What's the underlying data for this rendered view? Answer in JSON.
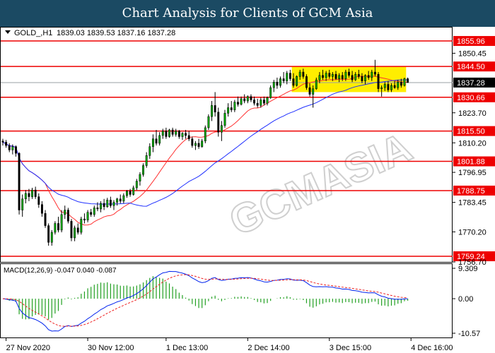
{
  "header": {
    "title": "Chart Analysis for Clients of GCM Asia"
  },
  "colors": {
    "title_bg": "#1b4a63",
    "bull": "#00aa00",
    "bear": "#000000",
    "ma_fast": "#ff3030",
    "ma_slow": "#2030ff",
    "hline": "#ee0000",
    "highlight": "#ffee00",
    "macd_hist": "#22a022",
    "macd_line": "#0022ee",
    "macd_signal": "#ee2020",
    "current_bg": "#000000"
  },
  "chart_data": [
    {
      "type": "candlestick",
      "symbol_label": "GOLD_,H1",
      "ohlc_label": "1839.03 1839.53 1837.16 1837.28",
      "ylim": [
        1756.7,
        1862.0
      ],
      "y_ticks": [
        "1850.45",
        "1823.70",
        "1810.20",
        "1796.95",
        "1783.45",
        "1770.20",
        "1756.70"
      ],
      "y_tick_values": [
        1850.45,
        1823.7,
        1810.2,
        1796.95,
        1783.45,
        1770.2,
        1756.7
      ],
      "levels": [
        {
          "value": 1855.96,
          "label": "1855.96"
        },
        {
          "value": 1844.5,
          "label": "1844.50"
        },
        {
          "value": 1830.66,
          "label": "1830.66"
        },
        {
          "value": 1815.5,
          "label": "1815.50"
        },
        {
          "value": 1801.88,
          "label": "1801.88"
        },
        {
          "value": 1788.75,
          "label": "1788.75"
        },
        {
          "value": 1759.24,
          "label": "1759.24"
        }
      ],
      "current_price": {
        "value": 1837.28,
        "label": "1837.28"
      },
      "highlight_zone": {
        "x_from": 88.5,
        "x_to": 123.5,
        "y_from": 1833.0,
        "y_to": 1844.5
      },
      "x_ticks": [
        {
          "label": "27 Nov 2020",
          "x": 1
        },
        {
          "label": "30 Nov 12:00",
          "x": 26
        },
        {
          "label": "1 Dec 13:00",
          "x": 50
        },
        {
          "label": "2 Dec 14:00",
          "x": 75
        },
        {
          "label": "3 Dec 15:00",
          "x": 100
        },
        {
          "label": "4 Dec 16:00",
          "x": 125
        }
      ],
      "x_range": [
        0,
        136
      ],
      "candles": [
        {
          "o": 1811.0,
          "h": 1812.0,
          "l": 1809.0,
          "c": 1810.5
        },
        {
          "o": 1810.5,
          "h": 1811.5,
          "l": 1808.0,
          "c": 1809.0
        },
        {
          "o": 1809.0,
          "h": 1810.0,
          "l": 1806.0,
          "c": 1807.0
        },
        {
          "o": 1807.0,
          "h": 1809.5,
          "l": 1805.0,
          "c": 1808.5
        },
        {
          "o": 1808.5,
          "h": 1809.0,
          "l": 1804.0,
          "c": 1805.5
        },
        {
          "o": 1805.5,
          "h": 1806.0,
          "l": 1778.0,
          "c": 1780.0
        },
        {
          "o": 1780.0,
          "h": 1787.0,
          "l": 1777.0,
          "c": 1785.0
        },
        {
          "o": 1785.0,
          "h": 1789.0,
          "l": 1783.0,
          "c": 1787.5
        },
        {
          "o": 1787.5,
          "h": 1789.5,
          "l": 1784.0,
          "c": 1786.0
        },
        {
          "o": 1786.0,
          "h": 1790.0,
          "l": 1785.0,
          "c": 1789.0
        },
        {
          "o": 1789.0,
          "h": 1790.5,
          "l": 1785.0,
          "c": 1786.0
        },
        {
          "o": 1786.0,
          "h": 1787.5,
          "l": 1781.0,
          "c": 1782.5
        },
        {
          "o": 1782.5,
          "h": 1784.0,
          "l": 1777.0,
          "c": 1778.5
        },
        {
          "o": 1778.5,
          "h": 1780.0,
          "l": 1772.0,
          "c": 1773.0
        },
        {
          "o": 1773.0,
          "h": 1774.0,
          "l": 1764.0,
          "c": 1765.5
        },
        {
          "o": 1765.5,
          "h": 1771.0,
          "l": 1764.0,
          "c": 1770.0
        },
        {
          "o": 1770.0,
          "h": 1775.0,
          "l": 1769.0,
          "c": 1774.0
        },
        {
          "o": 1774.0,
          "h": 1777.0,
          "l": 1770.0,
          "c": 1771.0
        },
        {
          "o": 1771.0,
          "h": 1780.0,
          "l": 1770.0,
          "c": 1778.0
        },
        {
          "o": 1778.0,
          "h": 1782.0,
          "l": 1776.0,
          "c": 1780.0
        },
        {
          "o": 1780.0,
          "h": 1781.0,
          "l": 1774.0,
          "c": 1775.0
        },
        {
          "o": 1775.0,
          "h": 1776.0,
          "l": 1766.0,
          "c": 1767.5
        },
        {
          "o": 1767.5,
          "h": 1773.0,
          "l": 1766.0,
          "c": 1772.0
        },
        {
          "o": 1772.0,
          "h": 1774.0,
          "l": 1769.0,
          "c": 1770.0
        },
        {
          "o": 1770.0,
          "h": 1777.0,
          "l": 1769.0,
          "c": 1776.0
        },
        {
          "o": 1776.0,
          "h": 1778.5,
          "l": 1774.0,
          "c": 1775.5
        },
        {
          "o": 1775.5,
          "h": 1780.0,
          "l": 1774.5,
          "c": 1779.0
        },
        {
          "o": 1779.0,
          "h": 1780.5,
          "l": 1777.0,
          "c": 1778.0
        },
        {
          "o": 1778.0,
          "h": 1782.0,
          "l": 1777.0,
          "c": 1781.0
        },
        {
          "o": 1781.0,
          "h": 1783.5,
          "l": 1779.5,
          "c": 1780.5
        },
        {
          "o": 1780.5,
          "h": 1784.0,
          "l": 1779.0,
          "c": 1783.0
        },
        {
          "o": 1783.0,
          "h": 1785.0,
          "l": 1780.0,
          "c": 1781.5
        },
        {
          "o": 1781.5,
          "h": 1785.5,
          "l": 1781.0,
          "c": 1784.5
        },
        {
          "o": 1784.5,
          "h": 1786.0,
          "l": 1781.0,
          "c": 1782.0
        },
        {
          "o": 1782.0,
          "h": 1784.5,
          "l": 1780.0,
          "c": 1783.5
        },
        {
          "o": 1783.5,
          "h": 1785.5,
          "l": 1782.0,
          "c": 1785.0
        },
        {
          "o": 1785.0,
          "h": 1787.0,
          "l": 1783.0,
          "c": 1784.0
        },
        {
          "o": 1784.0,
          "h": 1787.5,
          "l": 1783.0,
          "c": 1786.5
        },
        {
          "o": 1786.5,
          "h": 1789.0,
          "l": 1785.5,
          "c": 1788.5
        },
        {
          "o": 1788.5,
          "h": 1789.5,
          "l": 1786.0,
          "c": 1787.0
        },
        {
          "o": 1787.0,
          "h": 1791.0,
          "l": 1786.5,
          "c": 1790.0
        },
        {
          "o": 1790.0,
          "h": 1794.0,
          "l": 1789.0,
          "c": 1793.0
        },
        {
          "o": 1793.0,
          "h": 1797.0,
          "l": 1791.0,
          "c": 1796.0
        },
        {
          "o": 1796.0,
          "h": 1801.0,
          "l": 1795.0,
          "c": 1800.0
        },
        {
          "o": 1800.0,
          "h": 1806.0,
          "l": 1799.0,
          "c": 1804.5
        },
        {
          "o": 1804.5,
          "h": 1810.0,
          "l": 1803.0,
          "c": 1808.5
        },
        {
          "o": 1808.5,
          "h": 1814.0,
          "l": 1806.0,
          "c": 1812.0
        },
        {
          "o": 1812.0,
          "h": 1816.0,
          "l": 1809.0,
          "c": 1810.0
        },
        {
          "o": 1810.0,
          "h": 1815.0,
          "l": 1809.0,
          "c": 1813.5
        },
        {
          "o": 1813.5,
          "h": 1816.5,
          "l": 1812.0,
          "c": 1815.5
        },
        {
          "o": 1815.5,
          "h": 1817.0,
          "l": 1812.0,
          "c": 1813.0
        },
        {
          "o": 1813.0,
          "h": 1816.5,
          "l": 1812.5,
          "c": 1816.0
        },
        {
          "o": 1816.0,
          "h": 1817.0,
          "l": 1813.0,
          "c": 1814.0
        },
        {
          "o": 1814.0,
          "h": 1816.5,
          "l": 1813.0,
          "c": 1815.5
        },
        {
          "o": 1815.5,
          "h": 1816.0,
          "l": 1812.0,
          "c": 1813.0
        },
        {
          "o": 1813.0,
          "h": 1815.0,
          "l": 1811.5,
          "c": 1814.5
        },
        {
          "o": 1814.5,
          "h": 1816.0,
          "l": 1812.0,
          "c": 1813.5
        },
        {
          "o": 1813.5,
          "h": 1815.5,
          "l": 1811.0,
          "c": 1812.0
        },
        {
          "o": 1812.0,
          "h": 1813.0,
          "l": 1808.0,
          "c": 1809.0
        },
        {
          "o": 1809.0,
          "h": 1811.0,
          "l": 1807.0,
          "c": 1810.0
        },
        {
          "o": 1810.0,
          "h": 1812.0,
          "l": 1807.5,
          "c": 1808.5
        },
        {
          "o": 1808.5,
          "h": 1812.0,
          "l": 1808.0,
          "c": 1811.0
        },
        {
          "o": 1811.0,
          "h": 1818.0,
          "l": 1810.0,
          "c": 1817.0
        },
        {
          "o": 1817.0,
          "h": 1823.0,
          "l": 1816.0,
          "c": 1822.0
        },
        {
          "o": 1822.0,
          "h": 1829.0,
          "l": 1820.0,
          "c": 1827.0
        },
        {
          "o": 1827.0,
          "h": 1833.0,
          "l": 1822.0,
          "c": 1824.0
        },
        {
          "o": 1824.0,
          "h": 1826.0,
          "l": 1813.0,
          "c": 1815.0
        },
        {
          "o": 1815.0,
          "h": 1820.0,
          "l": 1811.0,
          "c": 1818.0
        },
        {
          "o": 1818.0,
          "h": 1825.0,
          "l": 1817.0,
          "c": 1823.5
        },
        {
          "o": 1823.5,
          "h": 1828.0,
          "l": 1822.0,
          "c": 1826.0
        },
        {
          "o": 1826.0,
          "h": 1829.0,
          "l": 1824.0,
          "c": 1825.0
        },
        {
          "o": 1825.0,
          "h": 1829.5,
          "l": 1824.0,
          "c": 1828.5
        },
        {
          "o": 1828.5,
          "h": 1831.0,
          "l": 1826.5,
          "c": 1827.5
        },
        {
          "o": 1827.5,
          "h": 1831.0,
          "l": 1827.0,
          "c": 1830.0
        },
        {
          "o": 1830.0,
          "h": 1832.0,
          "l": 1828.0,
          "c": 1829.0
        },
        {
          "o": 1829.0,
          "h": 1831.5,
          "l": 1828.0,
          "c": 1831.0
        },
        {
          "o": 1831.0,
          "h": 1832.0,
          "l": 1828.5,
          "c": 1829.5
        },
        {
          "o": 1829.5,
          "h": 1831.0,
          "l": 1827.0,
          "c": 1828.0
        },
        {
          "o": 1828.0,
          "h": 1830.0,
          "l": 1826.0,
          "c": 1827.0
        },
        {
          "o": 1827.0,
          "h": 1830.5,
          "l": 1826.0,
          "c": 1829.5
        },
        {
          "o": 1829.5,
          "h": 1831.0,
          "l": 1827.0,
          "c": 1828.0
        },
        {
          "o": 1828.0,
          "h": 1831.0,
          "l": 1827.0,
          "c": 1830.5
        },
        {
          "o": 1830.5,
          "h": 1836.0,
          "l": 1830.0,
          "c": 1835.0
        },
        {
          "o": 1835.0,
          "h": 1838.5,
          "l": 1833.0,
          "c": 1837.5
        },
        {
          "o": 1837.5,
          "h": 1839.5,
          "l": 1834.5,
          "c": 1836.0
        },
        {
          "o": 1836.0,
          "h": 1840.0,
          "l": 1835.0,
          "c": 1839.0
        },
        {
          "o": 1839.0,
          "h": 1842.0,
          "l": 1837.0,
          "c": 1838.0
        },
        {
          "o": 1838.0,
          "h": 1842.5,
          "l": 1836.5,
          "c": 1841.5
        },
        {
          "o": 1841.5,
          "h": 1843.0,
          "l": 1838.0,
          "c": 1839.0
        },
        {
          "o": 1839.0,
          "h": 1841.5,
          "l": 1835.0,
          "c": 1836.0
        },
        {
          "o": 1836.0,
          "h": 1840.5,
          "l": 1835.5,
          "c": 1840.0
        },
        {
          "o": 1840.0,
          "h": 1843.0,
          "l": 1838.5,
          "c": 1842.0
        },
        {
          "o": 1842.0,
          "h": 1843.5,
          "l": 1839.0,
          "c": 1840.0
        },
        {
          "o": 1840.0,
          "h": 1841.0,
          "l": 1834.0,
          "c": 1835.0
        },
        {
          "o": 1835.0,
          "h": 1837.0,
          "l": 1831.0,
          "c": 1832.0
        },
        {
          "o": 1832.0,
          "h": 1836.0,
          "l": 1826.0,
          "c": 1834.5
        },
        {
          "o": 1834.5,
          "h": 1839.5,
          "l": 1834.0,
          "c": 1838.5
        },
        {
          "o": 1838.5,
          "h": 1842.0,
          "l": 1837.0,
          "c": 1840.5
        },
        {
          "o": 1840.5,
          "h": 1843.0,
          "l": 1838.5,
          "c": 1839.5
        },
        {
          "o": 1839.5,
          "h": 1842.5,
          "l": 1838.0,
          "c": 1841.5
        },
        {
          "o": 1841.5,
          "h": 1843.0,
          "l": 1839.0,
          "c": 1840.0
        },
        {
          "o": 1840.0,
          "h": 1842.0,
          "l": 1838.0,
          "c": 1841.0
        },
        {
          "o": 1841.0,
          "h": 1842.5,
          "l": 1838.5,
          "c": 1839.0
        },
        {
          "o": 1839.0,
          "h": 1841.5,
          "l": 1837.5,
          "c": 1840.5
        },
        {
          "o": 1840.5,
          "h": 1842.0,
          "l": 1838.0,
          "c": 1839.0
        },
        {
          "o": 1839.0,
          "h": 1843.0,
          "l": 1838.0,
          "c": 1842.0
        },
        {
          "o": 1842.0,
          "h": 1843.5,
          "l": 1839.5,
          "c": 1840.5
        },
        {
          "o": 1840.5,
          "h": 1842.5,
          "l": 1837.5,
          "c": 1838.5
        },
        {
          "o": 1838.5,
          "h": 1842.0,
          "l": 1838.0,
          "c": 1841.0
        },
        {
          "o": 1841.0,
          "h": 1843.0,
          "l": 1839.0,
          "c": 1840.0
        },
        {
          "o": 1840.0,
          "h": 1841.5,
          "l": 1837.0,
          "c": 1838.0
        },
        {
          "o": 1838.0,
          "h": 1841.0,
          "l": 1836.5,
          "c": 1840.5
        },
        {
          "o": 1840.5,
          "h": 1842.5,
          "l": 1838.5,
          "c": 1839.5
        },
        {
          "o": 1839.5,
          "h": 1843.0,
          "l": 1838.0,
          "c": 1842.0
        },
        {
          "o": 1842.0,
          "h": 1847.5,
          "l": 1840.0,
          "c": 1841.0
        },
        {
          "o": 1841.0,
          "h": 1842.0,
          "l": 1833.0,
          "c": 1834.5
        },
        {
          "o": 1834.5,
          "h": 1836.0,
          "l": 1831.0,
          "c": 1835.0
        },
        {
          "o": 1835.0,
          "h": 1837.5,
          "l": 1833.5,
          "c": 1836.5
        },
        {
          "o": 1836.5,
          "h": 1838.0,
          "l": 1833.0,
          "c": 1834.0
        },
        {
          "o": 1834.0,
          "h": 1837.0,
          "l": 1833.0,
          "c": 1836.0
        },
        {
          "o": 1836.0,
          "h": 1838.0,
          "l": 1834.5,
          "c": 1835.0
        },
        {
          "o": 1835.0,
          "h": 1838.5,
          "l": 1834.0,
          "c": 1837.5
        },
        {
          "o": 1837.5,
          "h": 1839.0,
          "l": 1835.0,
          "c": 1836.0
        },
        {
          "o": 1836.0,
          "h": 1839.5,
          "l": 1835.5,
          "c": 1839.0
        },
        {
          "o": 1839.0,
          "h": 1839.53,
          "l": 1837.16,
          "c": 1837.28
        }
      ]
    },
    {
      "type": "macd",
      "label": "MACD(12,26,9) -0.047 0.040 -0.087",
      "ylim": [
        -10.57,
        9.309
      ],
      "y_ticks": [
        "9.309",
        "0.00",
        "-10.57"
      ],
      "y_tick_values": [
        9.309,
        0.0,
        -10.57
      ]
    }
  ],
  "watermark": {
    "text": "GCMASIA"
  }
}
